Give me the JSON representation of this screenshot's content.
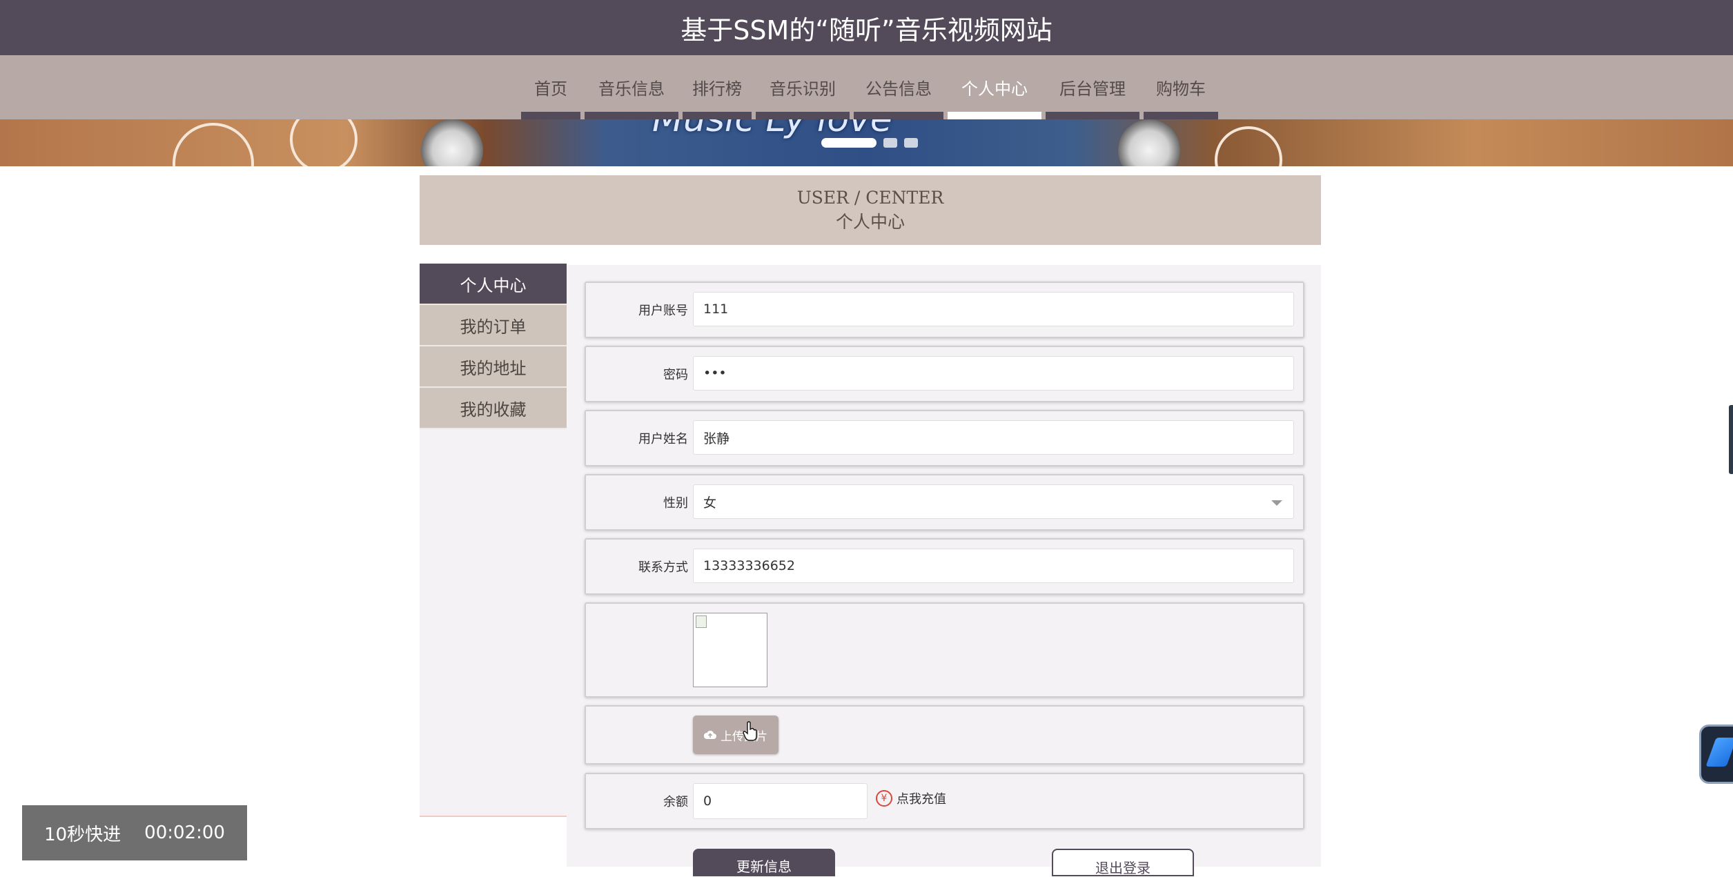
{
  "site": {
    "title": "基于SSM的“随听”音乐视频网站"
  },
  "nav": [
    {
      "label": "首页",
      "active": false
    },
    {
      "label": "音乐信息",
      "active": false
    },
    {
      "label": "排行榜",
      "active": false
    },
    {
      "label": "音乐识别",
      "active": false
    },
    {
      "label": "公告信息",
      "active": false
    },
    {
      "label": "个人中心",
      "active": true
    },
    {
      "label": "后台管理",
      "active": false
    },
    {
      "label": "购物车",
      "active": false
    }
  ],
  "banner": {
    "text": "Music Ly love",
    "slides": 3,
    "active_slide": 1
  },
  "section": {
    "title_en": "USER / CENTER",
    "title_cn": "个人中心"
  },
  "sidebar": {
    "items": [
      {
        "label": "个人中心",
        "active": true
      },
      {
        "label": "我的订单",
        "active": false
      },
      {
        "label": "我的地址",
        "active": false
      },
      {
        "label": "我的收藏",
        "active": false
      }
    ]
  },
  "form": {
    "account": {
      "label": "用户账号",
      "value": "111"
    },
    "password": {
      "label": "密码",
      "value": "•••"
    },
    "name": {
      "label": "用户姓名",
      "value": "张静"
    },
    "gender": {
      "label": "性别",
      "value": "女"
    },
    "phone": {
      "label": "联系方式",
      "value": "13333336652"
    },
    "photo": {
      "label": ""
    },
    "upload": {
      "label": "上传图片",
      "icon": "cloud-upload-icon"
    },
    "balance": {
      "label": "余额",
      "value": "0",
      "recharge_label": "点我充值",
      "recharge_icon": "yen-icon"
    },
    "update_button": "更新信息",
    "logout_button": "退出登录"
  },
  "overlay": {
    "fast_forward": "10秒快进",
    "time": "00:02:00"
  },
  "colors": {
    "header": "#534a5a",
    "nav": "#b7aaa6",
    "section": "#d3c6be",
    "accent": "#d9473d"
  }
}
